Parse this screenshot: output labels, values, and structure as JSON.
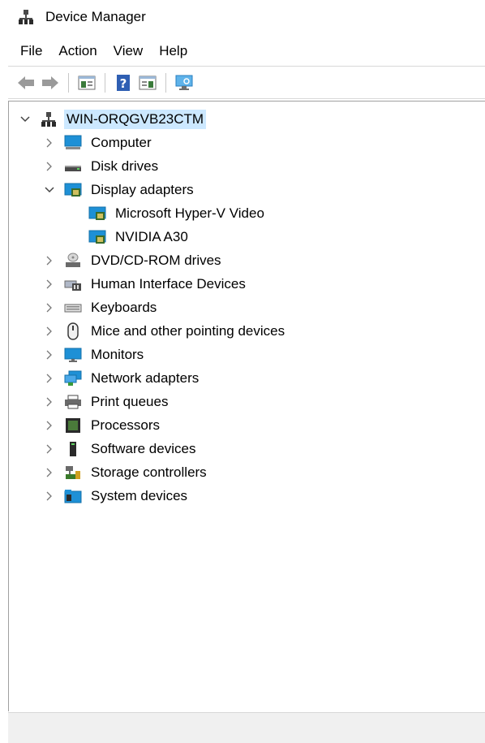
{
  "window": {
    "title": "Device Manager"
  },
  "menu": [
    "File",
    "Action",
    "View",
    "Help"
  ],
  "toolbar": {
    "buttons": [
      "back-icon",
      "forward-icon",
      "properties-icon",
      "help-icon",
      "update-driver-icon",
      "scan-hardware-icon"
    ]
  },
  "tree": {
    "root": "WIN-ORQGVB23CTM",
    "items": [
      {
        "label": "Computer",
        "icon": "computer-icon",
        "expanded": false
      },
      {
        "label": "Disk drives",
        "icon": "disk-drive-icon",
        "expanded": false
      },
      {
        "label": "Display adapters",
        "icon": "display-adapter-icon",
        "expanded": true,
        "children": [
          "Microsoft Hyper-V Video",
          "NVIDIA A30"
        ]
      },
      {
        "label": "DVD/CD-ROM drives",
        "icon": "dvd-drive-icon",
        "expanded": false
      },
      {
        "label": "Human Interface Devices",
        "icon": "hid-icon",
        "expanded": false
      },
      {
        "label": "Keyboards",
        "icon": "keyboard-icon",
        "expanded": false
      },
      {
        "label": "Mice and other pointing devices",
        "icon": "mouse-icon",
        "expanded": false
      },
      {
        "label": "Monitors",
        "icon": "monitor-icon",
        "expanded": false
      },
      {
        "label": "Network adapters",
        "icon": "network-adapter-icon",
        "expanded": false
      },
      {
        "label": "Print queues",
        "icon": "printer-icon",
        "expanded": false
      },
      {
        "label": "Processors",
        "icon": "processor-icon",
        "expanded": false
      },
      {
        "label": "Software devices",
        "icon": "software-device-icon",
        "expanded": false
      },
      {
        "label": "Storage controllers",
        "icon": "storage-controller-icon",
        "expanded": false
      },
      {
        "label": "System devices",
        "icon": "system-devices-icon",
        "expanded": false
      }
    ]
  },
  "colors": {
    "selection": "#cce8ff",
    "monitor_blue": "#1e90d6",
    "statusbar": "#f0f0f0"
  }
}
